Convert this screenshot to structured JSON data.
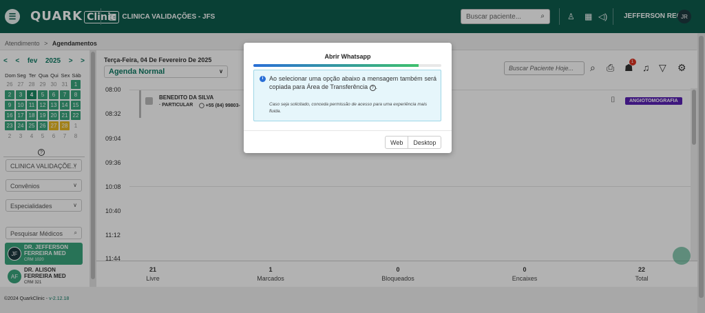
{
  "topbar": {
    "logo_main": "QUARK",
    "logo_box": "Clinic",
    "clinic_name": "CLINICA VALIDAÇÕES - JFS",
    "search_placeholder": "Buscar paciente...",
    "user_name": "JEFFERSON REC",
    "user_initials": "JR"
  },
  "breadcrumb": {
    "parent": "Atendimento",
    "separator": ">",
    "current": "Agendamentos"
  },
  "calendar": {
    "month": "fev",
    "year": "2025",
    "weekdays": [
      "Dom",
      "Seg",
      "Ter",
      "Qua",
      "Qui",
      "Sex",
      "Sáb"
    ],
    "weeks": [
      [
        {
          "d": "26",
          "s": "out"
        },
        {
          "d": "27",
          "s": "out"
        },
        {
          "d": "28",
          "s": "out"
        },
        {
          "d": "29",
          "s": "out"
        },
        {
          "d": "30",
          "s": "out"
        },
        {
          "d": "31",
          "s": "out"
        },
        {
          "d": "1",
          "s": "free"
        }
      ],
      [
        {
          "d": "2",
          "s": "free"
        },
        {
          "d": "3",
          "s": "free"
        },
        {
          "d": "4",
          "s": "sel"
        },
        {
          "d": "5",
          "s": "free"
        },
        {
          "d": "6",
          "s": "free"
        },
        {
          "d": "7",
          "s": "free"
        },
        {
          "d": "8",
          "s": "free"
        }
      ],
      [
        {
          "d": "9",
          "s": "free"
        },
        {
          "d": "10",
          "s": "free"
        },
        {
          "d": "11",
          "s": "free"
        },
        {
          "d": "12",
          "s": "free"
        },
        {
          "d": "13",
          "s": "free"
        },
        {
          "d": "14",
          "s": "free"
        },
        {
          "d": "15",
          "s": "free"
        }
      ],
      [
        {
          "d": "16",
          "s": "free"
        },
        {
          "d": "17",
          "s": "free"
        },
        {
          "d": "18",
          "s": "free"
        },
        {
          "d": "19",
          "s": "free"
        },
        {
          "d": "20",
          "s": "free"
        },
        {
          "d": "21",
          "s": "free"
        },
        {
          "d": "22",
          "s": "free"
        }
      ],
      [
        {
          "d": "23",
          "s": "free"
        },
        {
          "d": "24",
          "s": "free"
        },
        {
          "d": "25",
          "s": "free"
        },
        {
          "d": "26",
          "s": "free"
        },
        {
          "d": "27",
          "s": "warn"
        },
        {
          "d": "28",
          "s": "warn"
        },
        {
          "d": "1",
          "s": "out"
        }
      ],
      [
        {
          "d": "2",
          "s": "out"
        },
        {
          "d": "3",
          "s": "out"
        },
        {
          "d": "4",
          "s": "out"
        },
        {
          "d": "5",
          "s": "out"
        },
        {
          "d": "6",
          "s": "out"
        },
        {
          "d": "7",
          "s": "out"
        },
        {
          "d": "8",
          "s": "out"
        }
      ]
    ],
    "help": "?"
  },
  "filters": {
    "clinic": "CLINICA VALIDAÇÕE...",
    "convenios": "Convênios",
    "especialidades": "Especialidades",
    "search_doctors": "Pesquisar Médicos"
  },
  "doctors": [
    {
      "initials": "JF",
      "name": "DR. JEFFERSON FERREIRA MED",
      "crm": "CRM 1020"
    },
    {
      "initials": "AF",
      "name": "DR. ALISON FERREIRA MED",
      "crm": "CRM 321"
    }
  ],
  "main": {
    "date": "Terça-Feira, 04 De Fevereiro De 2025",
    "agenda": "Agenda Normal",
    "search_placeholder": "Buscar Paciente Hoje...",
    "times": [
      "08:00",
      "08:32",
      "09:04",
      "09:36",
      "10:08",
      "10:40",
      "11:12",
      "11:44"
    ],
    "appointment": {
      "patient": "BENEDITO DA SILVA",
      "insurance": "· PARTICULAR",
      "phone": "+55 (84) 99803-",
      "tag": "ANGIOTOMOGRAFIA"
    },
    "stats": [
      {
        "n": "21",
        "label": "Livre"
      },
      {
        "n": "1",
        "label": "Marcados"
      },
      {
        "n": "0",
        "label": "Bloqueados"
      },
      {
        "n": "0",
        "label": "Encaixes"
      },
      {
        "n": "22",
        "label": "Total"
      }
    ]
  },
  "footer": {
    "copyright": "©2024 QuarkClinic - ",
    "version": "v-2.12.18"
  },
  "modal": {
    "title": "Abrir Whatsapp",
    "progress_percent": 88,
    "message": "Ao selecionar uma opção abaixo a mensagem também será copiada para Área de Transferência",
    "message_help": "?",
    "note": "Caso seja solicitado, conceda permissão de acesso para uma experiência mais fluida.",
    "btn_web": "Web",
    "btn_desktop": "Desktop"
  },
  "colors": {
    "brand": "#0d5c4d",
    "accent": "#3aa57d",
    "tag": "#5a21b5",
    "warn": "#e8b923"
  }
}
